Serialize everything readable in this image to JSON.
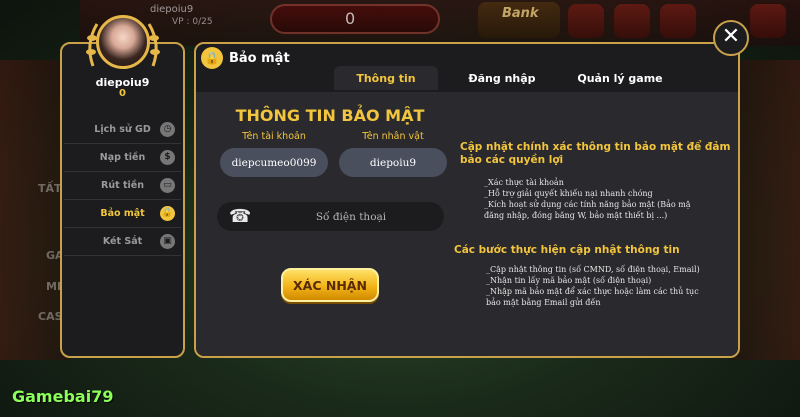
{
  "background": {
    "username": "diepoiu9",
    "vip": "VP : 0/25",
    "score": "0",
    "bank_label": "Bank",
    "side_texts": [
      "TẤT",
      "GA",
      "MI",
      "CAS"
    ]
  },
  "profile": {
    "username": "diepoiu9",
    "balance": "0"
  },
  "menu": [
    {
      "label": "Lịch sử GD",
      "icon": "clock-icon",
      "glyph": "◷"
    },
    {
      "label": "Nạp tiền",
      "icon": "coin-icon",
      "glyph": "$"
    },
    {
      "label": "Rút tiền",
      "icon": "card-icon",
      "glyph": "▭"
    },
    {
      "label": "Bảo mật",
      "icon": "lock-icon",
      "glyph": "🔒"
    },
    {
      "label": "Két Sắt",
      "icon": "safe-icon",
      "glyph": "▣"
    }
  ],
  "dialog": {
    "title": "Bảo mật",
    "tabs": [
      "Thông tin",
      "Đăng nhập",
      "Quản lý game"
    ],
    "section_title": "THÔNG TIN BẢO MẬT",
    "account_label": "Tên tài khoản",
    "account_value": "diepcumeo0099",
    "character_label": "Tên nhân vật",
    "character_value": "diepoiu9",
    "phone_placeholder": "Số điện thoại",
    "confirm_label": "XÁC NHẬN"
  },
  "info": {
    "head1_line1": "Cập nhật chính xác thông tin bảo mật để đảm",
    "head1_line2": "bảo các quyền lợi",
    "list1": [
      "_Xác thực tài khoản",
      "_Hỗ trợ giải quyết khiếu nại nhanh chóng",
      "_Kích hoạt sử dụng các tính năng bảo mật (Bảo mậ",
      "đăng nhập, đóng băng W, bảo mật thiết bị ...)"
    ],
    "head2": "Các bước thực hiện cập nhật thông tin",
    "list2": [
      "_Cập nhật thông tin (số CMND, số điện thoại, Email)",
      "_Nhận tin lấy mã bảo mật (số điện thoại)",
      "_Nhập mã bảo mật để xác thực hoặc làm các thủ tục",
      "bảo mật bằng Email gửi đến"
    ]
  },
  "brand": "Gamebai79",
  "colors": {
    "accent": "#f2c53d",
    "panel": "#1c1c1f",
    "border": "#c9a14a"
  }
}
